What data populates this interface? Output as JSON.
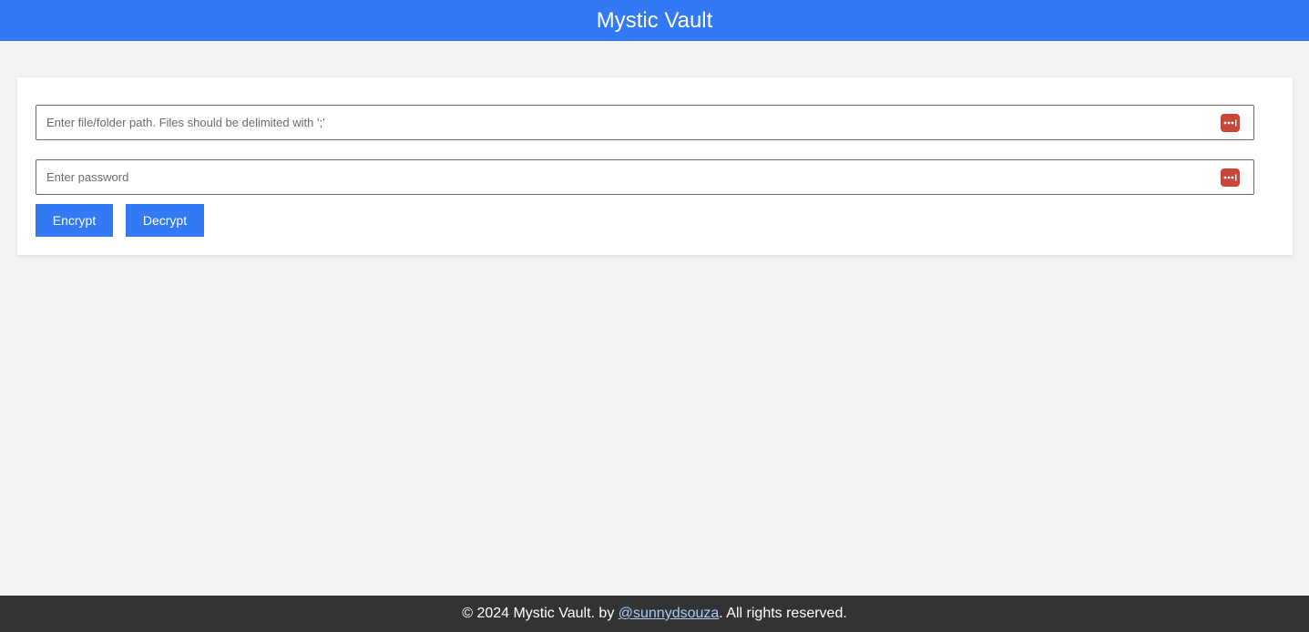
{
  "header": {
    "title": "Mystic Vault"
  },
  "form": {
    "path_placeholder": "Enter file/folder path. Files should be delimited with ';'",
    "path_value": "",
    "password_placeholder": "Enter password",
    "password_value": "",
    "password_manager_icon": "password-dots-icon",
    "encrypt_label": "Encrypt",
    "decrypt_label": "Decrypt"
  },
  "footer": {
    "prefix": "© 2024 Mystic Vault. by ",
    "author_link": "@sunnydsouza",
    "suffix": ". All rights reserved."
  },
  "colors": {
    "accent": "#3479f4",
    "footer_bg": "#333333",
    "icon_red": "#c9463b",
    "link": "#a9cdf5"
  }
}
